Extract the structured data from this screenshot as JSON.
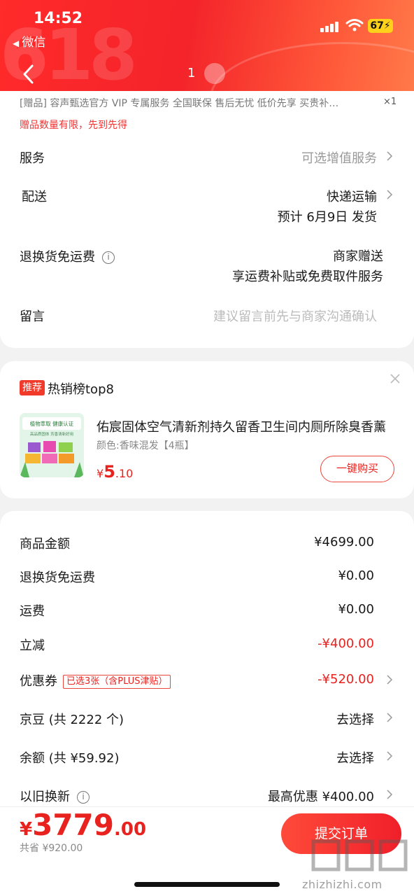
{
  "status_bar": {
    "time": "14:52",
    "back_app": "微信",
    "battery": "67"
  },
  "nav": {
    "page_number": "1"
  },
  "gift": {
    "text": "[赠品] 容声甄选官方 VIP 专属服务 全国联保 售后无忧 低价先享 买贵补…",
    "qty": "×1",
    "limit_note": "赠品数量有限，先到先得"
  },
  "order_options": [
    {
      "label": "服务",
      "value": "可选增值服务"
    },
    {
      "label": "配送",
      "value": "快递运输",
      "sub": "预计 6月9日 发货"
    },
    {
      "label": "退换货免运费",
      "value": "商家赠送",
      "sub": "享运费补贴或免费取件服务"
    },
    {
      "label": "留言",
      "placeholder": "建议留言前先与商家沟通确认"
    }
  ],
  "recommend": {
    "tag": "推荐",
    "title": "热销榜top8",
    "product_name": "佑宸固体空气清新剂持久留香卫生间内厕所除臭香薰",
    "spec": "颜色:香味混发【4瓶】",
    "price_symbol": "¥",
    "price_int": "5",
    "price_dec": ".10",
    "buy_label": "一键购买",
    "thumb_text1": "植物萃取 健康认证",
    "thumb_text2": "高品质固体 芳香清新好用"
  },
  "summary": {
    "rows": [
      {
        "label": "商品金额",
        "value": "¥4699.00"
      },
      {
        "label": "退换货免运费",
        "value": "¥0.00"
      },
      {
        "label": "运费",
        "value": "¥0.00"
      },
      {
        "label": "立减",
        "value": "-¥400.00"
      },
      {
        "label": "优惠券",
        "tag": "已选3张（含PLUS津贴）",
        "value": "-¥520.00"
      },
      {
        "label": "京豆 (共 2222 个)",
        "value": "去选择"
      },
      {
        "label": "余额 (共 ¥59.92)",
        "value": "去选择"
      },
      {
        "label": "以旧换新",
        "value": "最高优惠 ¥400.00"
      }
    ]
  },
  "footer": {
    "currency": "¥",
    "total_int": "3779",
    "total_dec": ".00",
    "saved": "共省 ¥920.00",
    "submit_label": "提交订单"
  },
  "watermark": {
    "domain": "zhizhizhi.com"
  },
  "colors": {
    "accent": "#e8231f",
    "header": "#f4242a"
  }
}
